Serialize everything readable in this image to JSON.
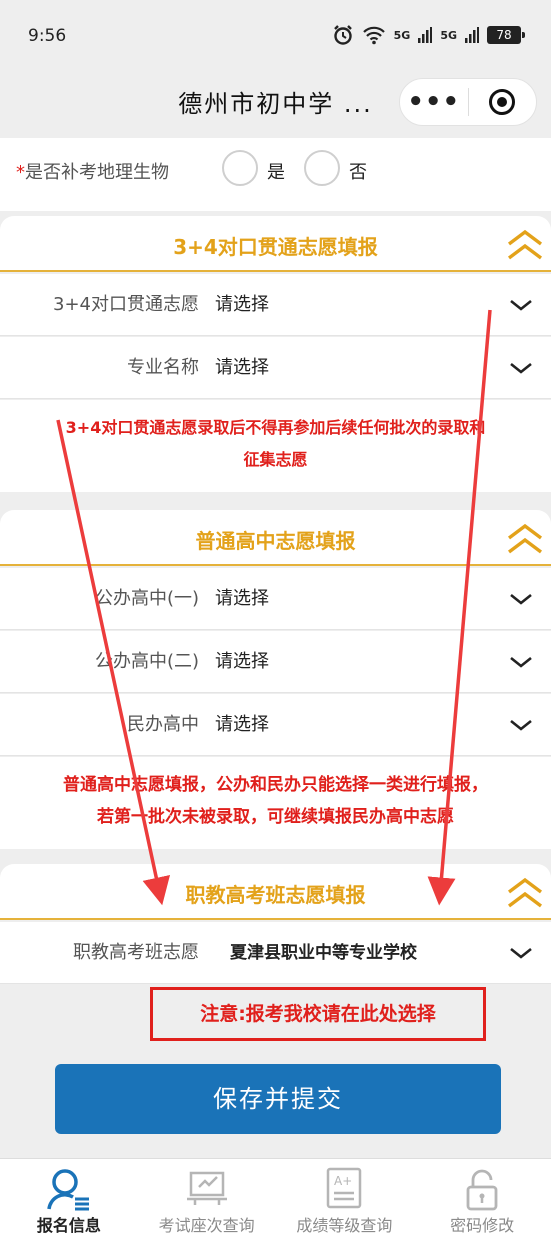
{
  "status": {
    "time": "9:56",
    "battery": "78",
    "signal1": "5G",
    "signal2": "5G"
  },
  "nav": {
    "title": "德州市初中学 ...",
    "more": "•••"
  },
  "top_question": {
    "required_mark": "*",
    "label": "是否补考地理生物",
    "option_yes": "是",
    "option_no": "否"
  },
  "section1": {
    "title": "3+4对口贯通志愿填报",
    "rows": [
      {
        "label": "3+4对口贯通志愿",
        "value": "请选择"
      },
      {
        "label": "专业名称",
        "value": "请选择"
      }
    ],
    "note_line1": "3+4对口贯通志愿录取后不得再参加后续任何批次的录取和",
    "note_line2": "征集志愿"
  },
  "section2": {
    "title": "普通高中志愿填报",
    "rows": [
      {
        "label": "公办高中(一)",
        "value": "请选择"
      },
      {
        "label": "公办高中(二)",
        "value": "请选择"
      },
      {
        "label": "民办高中",
        "value": "请选择"
      }
    ],
    "note_line1": "普通高中志愿填报，公办和民办只能选择一类进行填报，",
    "note_line2": "若第一批次未被录取，可继续填报民办高中志愿"
  },
  "section3": {
    "title": "职教高考班志愿填报",
    "rows": [
      {
        "label": "职教高考班志愿",
        "value": "夏津县职业中等专业学校"
      }
    ]
  },
  "annotation": "注意:报考我校请在此处选择",
  "submit_label": "保存并提交",
  "tabs": [
    {
      "label": "报名信息",
      "icon": "person-list-icon",
      "active": true
    },
    {
      "label": "考试座次查询",
      "icon": "seat-query-icon",
      "active": false
    },
    {
      "label": "成绩等级查询",
      "icon": "grade-document-icon",
      "active": false
    },
    {
      "label": "密码修改",
      "icon": "lock-icon",
      "active": false
    }
  ],
  "colors": {
    "accent": "#e3a21a",
    "warning": "#e0201c",
    "primary": "#1a73b8"
  }
}
